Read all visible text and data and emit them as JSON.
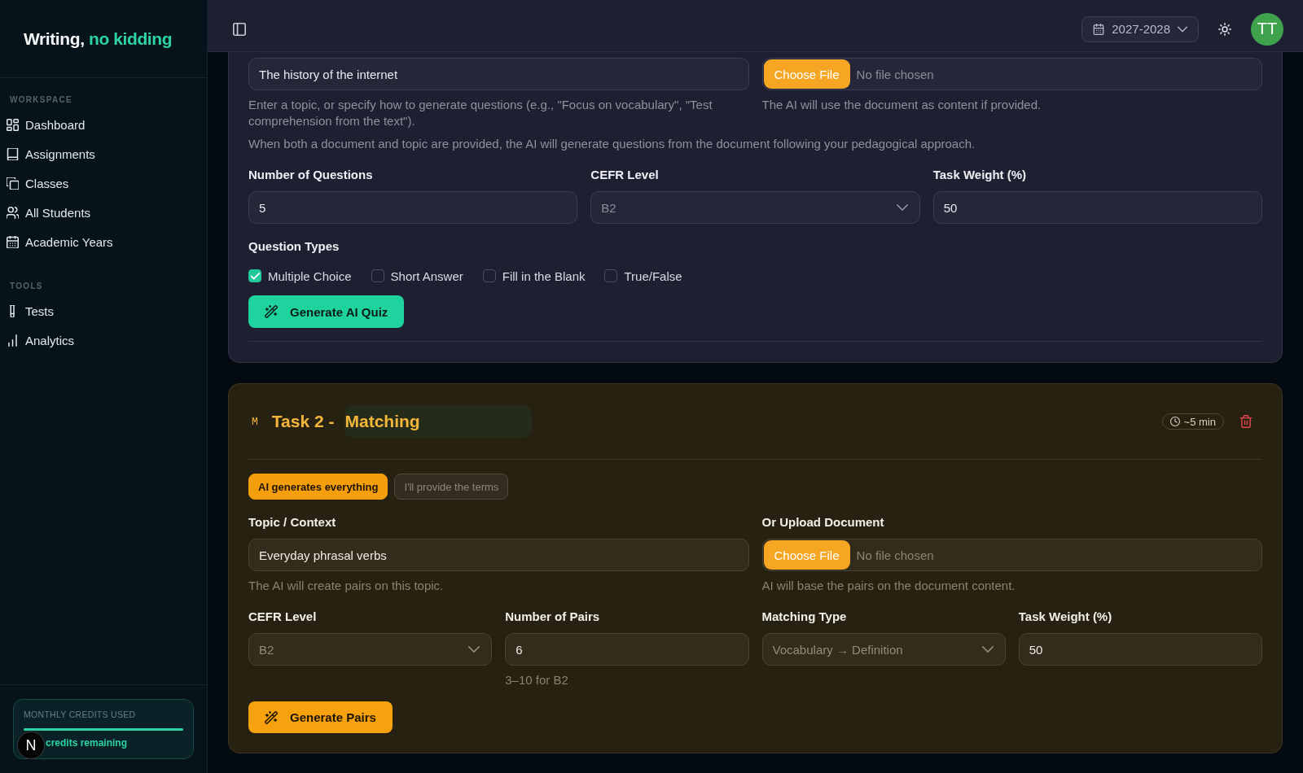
{
  "sidebar": {
    "logo": {
      "text": "Writing,",
      "accent": "no kidding"
    },
    "sections": [
      {
        "heading": "WORKSPACE",
        "items": [
          {
            "label": "Dashboard",
            "selected": false
          },
          {
            "label": "Assignments",
            "selected": false
          },
          {
            "label": "Classes",
            "selected": false
          },
          {
            "label": "All Students",
            "selected": false
          },
          {
            "label": "Academic Years",
            "selected": false
          }
        ]
      },
      {
        "heading": "TOOLS",
        "items": [
          {
            "label": "Tests",
            "selected": false
          },
          {
            "label": "Analytics",
            "selected": false
          }
        ]
      }
    ],
    "credits": {
      "label": "MONTHLY CREDITS USED",
      "level": 1,
      "remaining": "credits remaining"
    }
  },
  "dev_badge": "N",
  "header": {
    "year": "2027-2028",
    "avatar": "TT"
  },
  "task_1": {
    "topic": {
      "value": "The history of the internet",
      "help": "Enter a topic, or specify how to generate questions (e.g., \"Focus on vocabulary\", \"Test comprehension from the text\")."
    },
    "upload": {
      "button": "Choose File",
      "status": "No file chosen",
      "help": "The AI will use the document as content if provided."
    },
    "note": "When both a document and topic are provided, the AI will generate questions from the document following your pedagogical approach.",
    "fields": [
      {
        "label": "Number of Questions",
        "kind": "input",
        "value": "5"
      },
      {
        "label": "CEFR Level",
        "kind": "select",
        "value": "B2"
      },
      {
        "label": "Task Weight (%)",
        "kind": "input",
        "value": "50"
      }
    ],
    "question_types": {
      "label": "Question Types",
      "options": [
        {
          "label": "Multiple Choice",
          "checked": true
        },
        {
          "label": "Short Answer",
          "checked": false
        },
        {
          "label": "Fill in the Blank",
          "checked": false
        },
        {
          "label": "True/False",
          "checked": false
        }
      ]
    },
    "button": "Generate AI Quiz"
  },
  "task_2": {
    "badge": "M",
    "title_prefix": "Task 2 -",
    "title": "Matching",
    "duration": "~5 min",
    "modes": [
      {
        "label": "AI generates everything",
        "selected": true
      },
      {
        "label": "I'll provide the terms",
        "selected": false
      }
    ],
    "topic": {
      "label": "Topic / Context",
      "value": "Everyday phrasal verbs",
      "help": "The AI will create pairs on this topic."
    },
    "upload": {
      "label": "Or Upload Document",
      "button": "Choose File",
      "status": "No file chosen",
      "help": "AI will base the pairs on the document content."
    },
    "fields": [
      {
        "label": "CEFR Level",
        "kind": "select",
        "value": "B2"
      },
      {
        "label": "Number of Pairs",
        "kind": "input",
        "value": "6",
        "hint": "3–10 for B2"
      },
      {
        "label": "Matching Type",
        "kind": "select",
        "value": "Vocabulary → Definition"
      },
      {
        "label": "Task Weight (%)",
        "kind": "input",
        "value": "50"
      }
    ],
    "button": "Generate Pairs"
  }
}
